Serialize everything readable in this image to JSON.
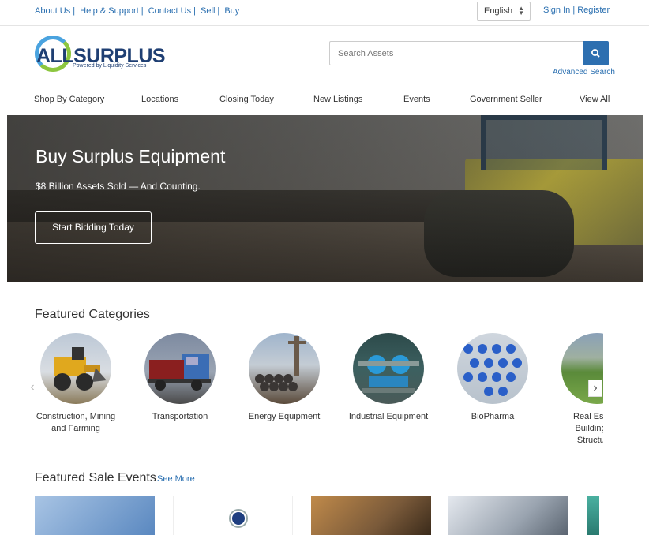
{
  "top_links": [
    "About Us",
    "Help & Support",
    "Contact Us",
    "Sell",
    "Buy"
  ],
  "language": {
    "selected": "English"
  },
  "auth": {
    "sign_in": "Sign In",
    "register": "Register"
  },
  "logo": {
    "wordmark": "ALLSURPLUS",
    "tagline": "Powered by Liquidity Services"
  },
  "search": {
    "placeholder": "Search Assets",
    "advanced": "Advanced Search"
  },
  "nav": [
    "Shop By Category",
    "Locations",
    "Closing Today",
    "New Listings",
    "Events",
    "Government Seller",
    "View All"
  ],
  "hero": {
    "title": "Buy Surplus Equipment",
    "subtitle": "$8 Billion Assets Sold — And Counting.",
    "cta": "Start Bidding Today"
  },
  "featured_categories": {
    "title": "Featured Categories",
    "items": [
      {
        "label": "Construction, Mining and Farming",
        "icon": "wheel-loader"
      },
      {
        "label": "Transportation",
        "icon": "semi-truck"
      },
      {
        "label": "Energy Equipment",
        "icon": "drill-pipes"
      },
      {
        "label": "Industrial Equipment",
        "icon": "pumps"
      },
      {
        "label": "BioPharma",
        "icon": "vials"
      },
      {
        "label": "Real Estate, Buildings & Structures",
        "icon": "farmland"
      }
    ]
  },
  "featured_sale_events": {
    "title": "Featured Sale Events",
    "see_more": "See More"
  },
  "colors": {
    "link": "#2a6fb0",
    "brand_navy": "#1f3f73",
    "search_button": "#2d6fb0"
  }
}
